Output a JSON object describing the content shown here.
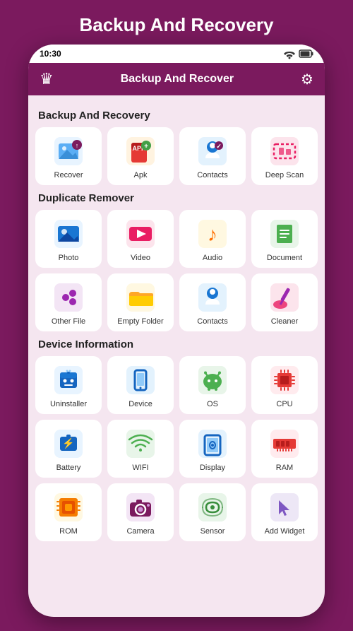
{
  "page": {
    "title": "Backup And Recovery",
    "status_bar": {
      "time": "10:30"
    },
    "app_header": {
      "title": "Backup And Recover"
    }
  },
  "sections": [
    {
      "title": "Backup And Recovery",
      "items": [
        {
          "label": "Recover",
          "icon": "recover"
        },
        {
          "label": "Apk",
          "icon": "apk"
        },
        {
          "label": "Contacts",
          "icon": "contacts-backup"
        },
        {
          "label": "Deep Scan",
          "icon": "deep-scan"
        }
      ]
    },
    {
      "title": "Duplicate Remover",
      "items": [
        {
          "label": "Photo",
          "icon": "photo"
        },
        {
          "label": "Video",
          "icon": "video"
        },
        {
          "label": "Audio",
          "icon": "audio"
        },
        {
          "label": "Document",
          "icon": "document"
        },
        {
          "label": "Other File",
          "icon": "other-file"
        },
        {
          "label": "Empty Folder",
          "icon": "empty-folder"
        },
        {
          "label": "Contacts",
          "icon": "contacts-dup"
        },
        {
          "label": "Cleaner",
          "icon": "cleaner"
        }
      ]
    },
    {
      "title": "Device Information",
      "items": [
        {
          "label": "Uninstaller",
          "icon": "uninstaller"
        },
        {
          "label": "Device",
          "icon": "device"
        },
        {
          "label": "OS",
          "icon": "os"
        },
        {
          "label": "CPU",
          "icon": "cpu"
        },
        {
          "label": "Battery",
          "icon": "battery"
        },
        {
          "label": "WIFI",
          "icon": "wifi"
        },
        {
          "label": "Display",
          "icon": "display"
        },
        {
          "label": "RAM",
          "icon": "ram"
        },
        {
          "label": "ROM",
          "icon": "rom"
        },
        {
          "label": "Camera",
          "icon": "camera"
        },
        {
          "label": "Sensor",
          "icon": "sensor"
        },
        {
          "label": "Add Widget",
          "icon": "add-widget"
        }
      ]
    }
  ]
}
